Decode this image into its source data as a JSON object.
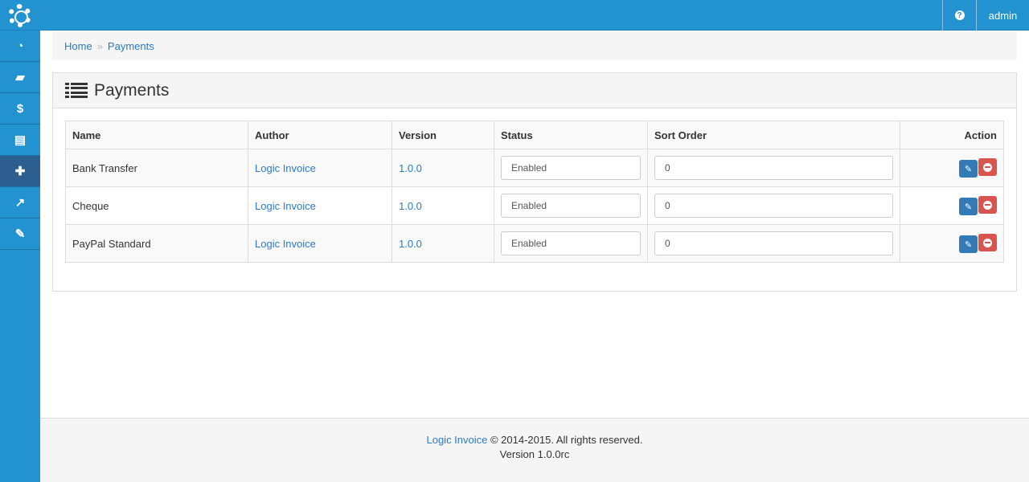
{
  "topbar": {
    "help_icon": "question-circle-icon",
    "user": "admin"
  },
  "sidebar": {
    "items": [
      {
        "icon": "dashboard-icon"
      },
      {
        "icon": "book-icon"
      },
      {
        "icon": "dollar-icon",
        "glyph": "$"
      },
      {
        "icon": "newspaper-icon"
      },
      {
        "icon": "puzzle-icon",
        "active": true
      },
      {
        "icon": "line-chart-icon"
      },
      {
        "icon": "wrench-icon"
      }
    ]
  },
  "breadcrumb": {
    "items": [
      "Home",
      "Payments"
    ]
  },
  "panel": {
    "title": "Payments"
  },
  "table": {
    "headers": [
      "Name",
      "Author",
      "Version",
      "Status",
      "Sort Order",
      "Action"
    ],
    "rows": [
      {
        "name": "Bank Transfer",
        "author": "Logic Invoice",
        "version": "1.0.0",
        "status": "Enabled",
        "sort_order": "0"
      },
      {
        "name": "Cheque",
        "author": "Logic Invoice",
        "version": "1.0.0",
        "status": "Enabled",
        "sort_order": "0"
      },
      {
        "name": "PayPal Standard",
        "author": "Logic Invoice",
        "version": "1.0.0",
        "status": "Enabled",
        "sort_order": "0"
      }
    ]
  },
  "footer": {
    "brand": "Logic Invoice",
    "copyright": " © 2014-2015. All rights reserved.",
    "version": "Version 1.0.0rc"
  },
  "colors": {
    "primary": "#2292d0",
    "edit": "#337ab7",
    "delete": "#d9534f"
  }
}
